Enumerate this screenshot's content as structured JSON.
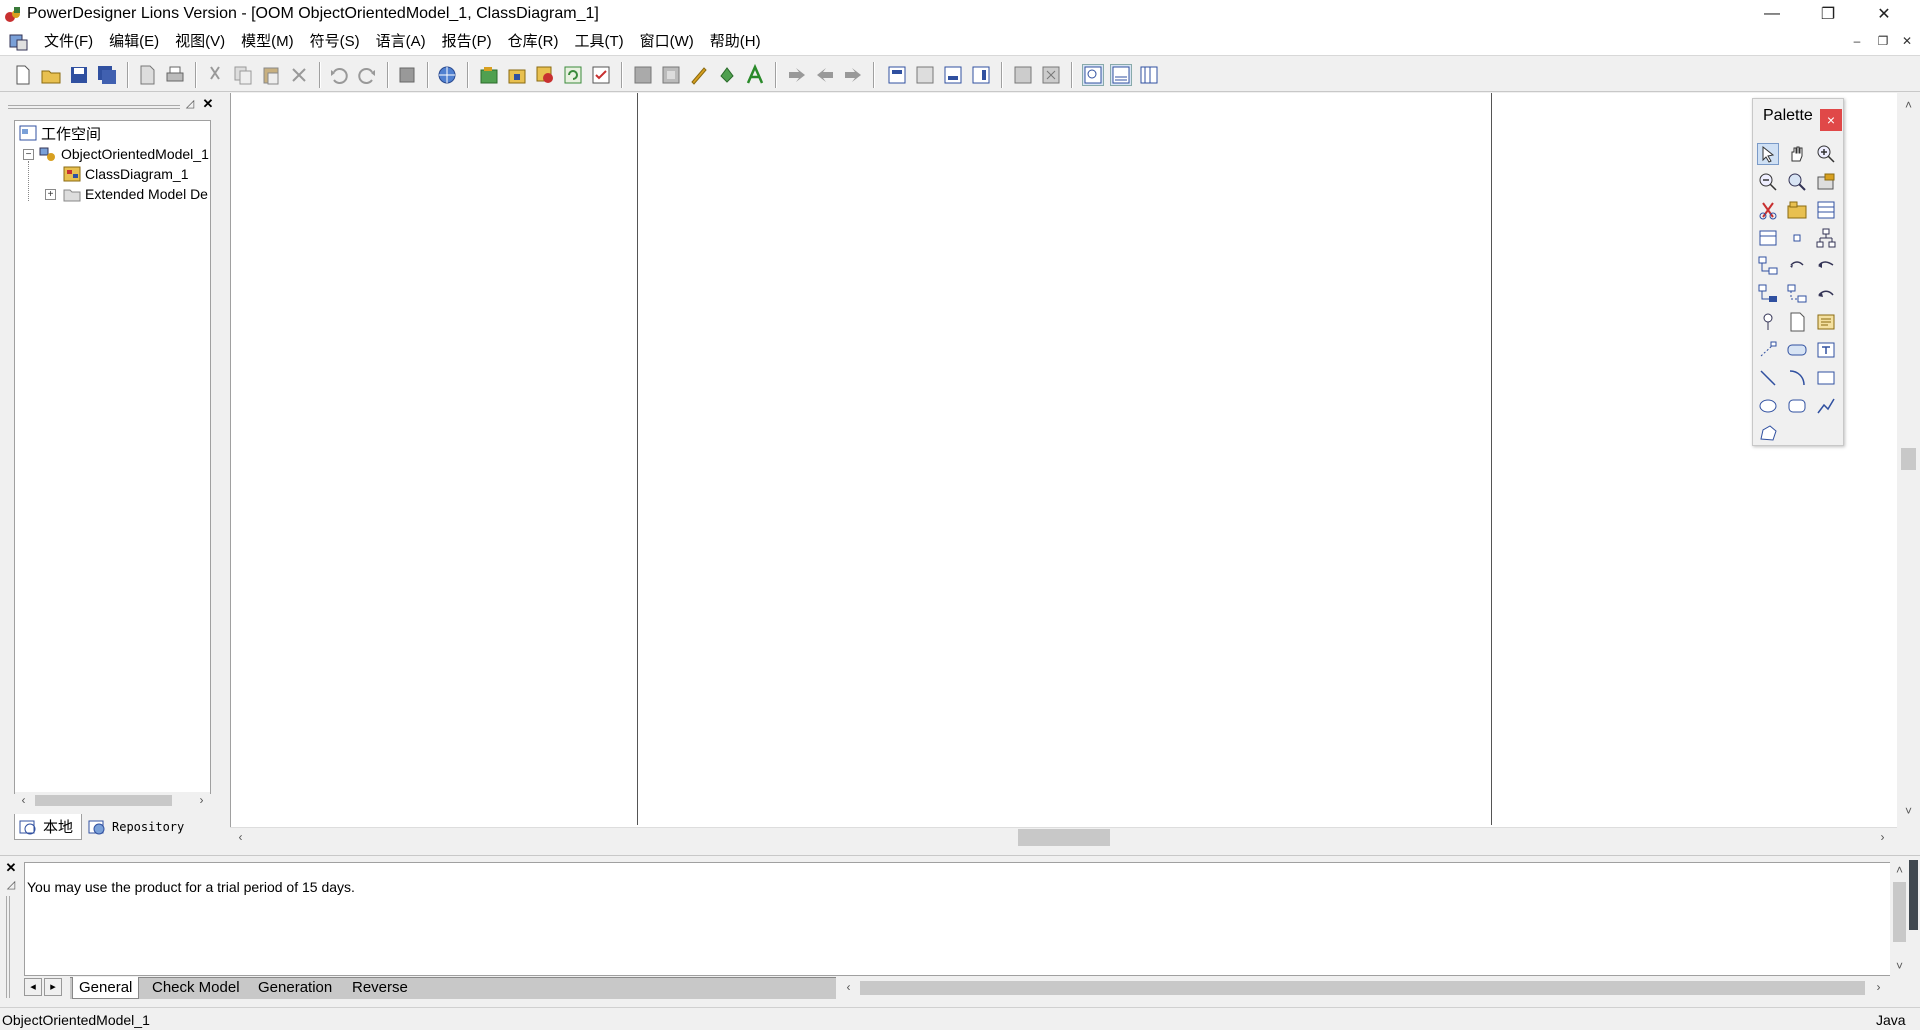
{
  "window": {
    "title": "PowerDesigner Lions Version - [OOM ObjectOrientedModel_1, ClassDiagram_1]",
    "minimize": "—",
    "restore": "❐",
    "close": "✕"
  },
  "menu": {
    "items": [
      "文件(F)",
      "编辑(E)",
      "视图(V)",
      "模型(M)",
      "符号(S)",
      "语言(A)",
      "报告(P)",
      "仓库(R)",
      "工具(T)",
      "窗口(W)",
      "帮助(H)"
    ],
    "mdi_min": "–",
    "mdi_restore": "❐",
    "mdi_close": "✕"
  },
  "browser": {
    "root": "工作空间",
    "model": "ObjectOrientedModel_1",
    "diagram": "ClassDiagram_1",
    "extended": "Extended Model De",
    "tab_local": "本地",
    "tab_repository": "Repository",
    "expander_minus": "−",
    "expander_plus": "+"
  },
  "palette": {
    "title": "Palette",
    "close": "×"
  },
  "output": {
    "message": "You may use the product for a trial period of 15 days.",
    "tabs": [
      "General",
      "Check Model",
      "Generation",
      "Reverse"
    ]
  },
  "status": {
    "left": "ObjectOrientedModel_1",
    "right": "Java"
  }
}
